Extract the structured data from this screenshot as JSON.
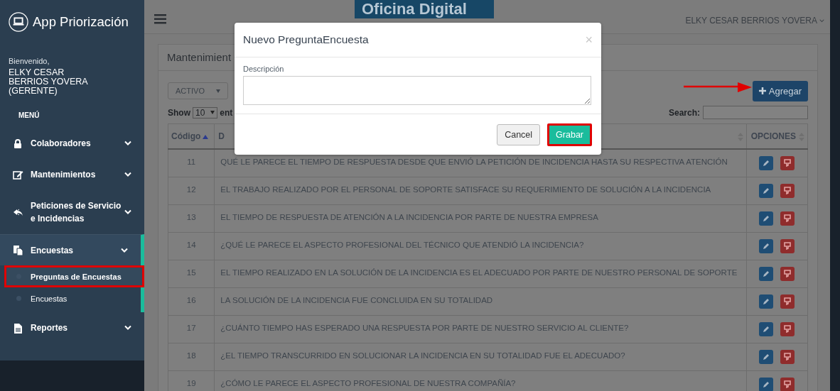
{
  "app_title": "App Priorización",
  "sidebar": {
    "welcome": "Bienvenido,",
    "user": "ELKY CESAR BERRIOS YOVERA (GERENTE)",
    "menu_label": "MENÚ",
    "items": [
      {
        "label": "Colaboradores",
        "expanded": false
      },
      {
        "label": "Mantenimientos",
        "expanded": false
      },
      {
        "label": "Peticiones de Servicio e Incidencias",
        "expanded": false
      },
      {
        "label": "Encuestas",
        "expanded": true,
        "children": [
          {
            "label": "Preguntas de Encuestas",
            "selected": true
          },
          {
            "label": "Encuestas",
            "selected": false
          }
        ]
      },
      {
        "label": "Reportes",
        "expanded": false
      }
    ]
  },
  "topbar": {
    "banner": "Oficina Digital",
    "user_menu": "ELKY CESAR BERRIOS YOVERA"
  },
  "panel": {
    "title": "Mantenimient",
    "status_filter": "ACTIVO",
    "show_label": "Show",
    "page_size": "10",
    "entries_label": "ent",
    "add_button": "Agregar",
    "search_label": "Search:",
    "table": {
      "columns": [
        "Código",
        "D",
        "OPCIONES"
      ],
      "rows": [
        {
          "code": "11",
          "description": "QUÉ LE PARECE EL TIEMPO DE RESPUESTA DESDE QUE ENVIÓ LA PETICIÓN DE INCIDENCIA HASTA SU RESPECTIVA ATENCIÓN"
        },
        {
          "code": "12",
          "description": "EL TRABAJO REALIZADO POR EL PERSONAL DE SOPORTE SATISFACE SU REQUERIMIENTO DE SOLUCIÓN A LA INCIDENCIA"
        },
        {
          "code": "13",
          "description": "EL TIEMPO DE RESPUESTA DE ATENCIÓN A LA INCIDENCIA POR PARTE DE NUESTRA EMPRESA"
        },
        {
          "code": "14",
          "description": "¿QUÉ LE PARECE EL ASPECTO PROFESIONAL DEL TÉCNICO QUE ATENDIÓ LA INCIDENCIA?"
        },
        {
          "code": "15",
          "description": "EL TIEMPO REALIZADO EN LA SOLUCIÓN DE LA INCIDENCIA ES EL ADECUADO POR PARTE DE NUESTRO PERSONAL DE SOPORTE"
        },
        {
          "code": "16",
          "description": "LA SOLUCIÓN DE LA INCIDENCIA FUE CONCLUIDA EN SU TOTALIDAD"
        },
        {
          "code": "17",
          "description": "¿CUÁNTO TIEMPO HAS ESPERADO UNA RESPUESTA POR PARTE DE NUESTRO SERVICIO AL CLIENTE?"
        },
        {
          "code": "18",
          "description": "¿EL TIEMPO TRANSCURRIDO EN SOLUCIONAR LA INCIDENCIA EN SU TOTALIDAD FUE EL ADECUADO?"
        },
        {
          "code": "19",
          "description": "¿CÓMO LE PARECE EL ASPECTO PROFESIONAL DE NUESTRA COMPAÑÍA?"
        }
      ]
    }
  },
  "modal": {
    "title": "Nuevo PreguntaEncuesta",
    "close": "×",
    "field_label": "Descripción",
    "cancel": "Cancel",
    "save": "Grabar"
  }
}
